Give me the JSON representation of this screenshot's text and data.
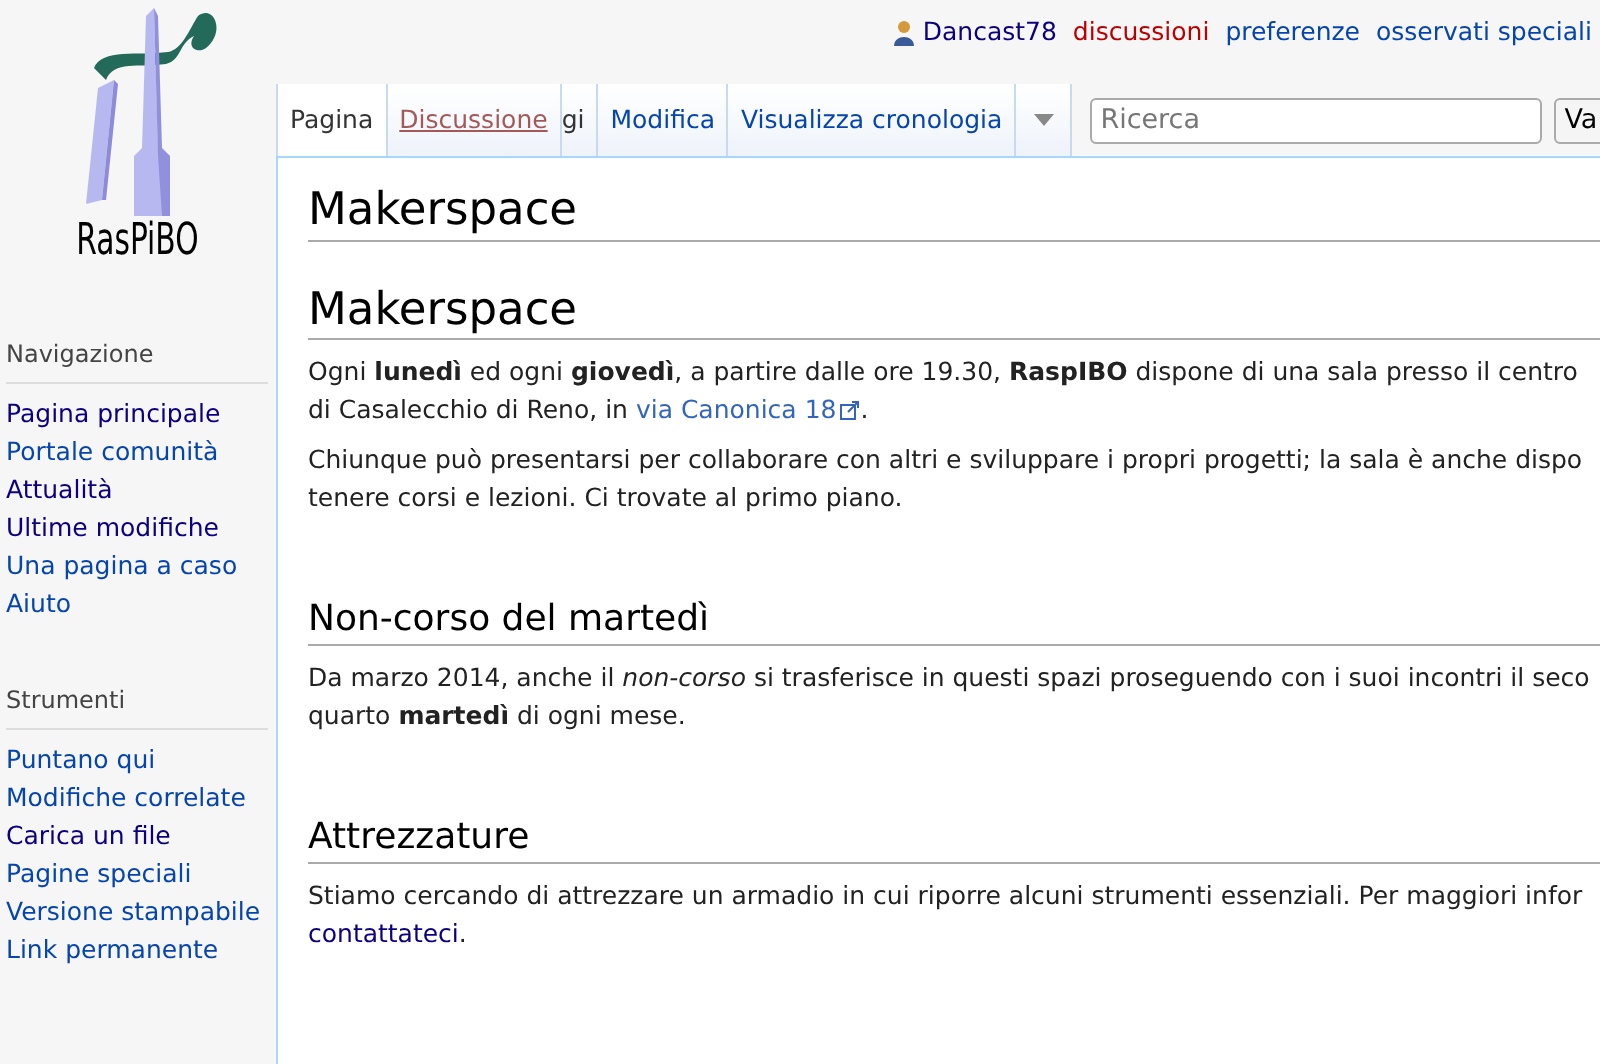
{
  "logo": {
    "text": "RasPiBO"
  },
  "personal_links": [
    {
      "label": "Dancast78",
      "kind": "user"
    },
    {
      "label": "discussioni",
      "kind": "new"
    },
    {
      "label": "preferenze",
      "kind": "link"
    },
    {
      "label": "osservati speciali",
      "kind": "link"
    }
  ],
  "tabs": [
    {
      "label": "Pagina",
      "selected": true,
      "kind": "tab"
    },
    {
      "label": "Discussione",
      "selected": false,
      "kind": "new"
    },
    {
      "label": "gi",
      "selected": false,
      "kind": "hidden"
    },
    {
      "label": "Modifica",
      "selected": false,
      "kind": "tab"
    },
    {
      "label": "Visualizza cronologia",
      "selected": false,
      "kind": "tab"
    }
  ],
  "search": {
    "placeholder": "Ricerca",
    "button": "Va"
  },
  "sidebar": [
    {
      "title": "Navigazione",
      "items": [
        {
          "label": "Pagina principale",
          "visited": true
        },
        {
          "label": "Portale comunità",
          "visited": false
        },
        {
          "label": "Attualità",
          "visited": true
        },
        {
          "label": "Ultime modifiche",
          "visited": true
        },
        {
          "label": "Una pagina a caso",
          "visited": false
        },
        {
          "label": "Aiuto",
          "visited": false
        }
      ]
    },
    {
      "title": "Strumenti",
      "items": [
        {
          "label": "Puntano qui",
          "visited": false
        },
        {
          "label": "Modifiche correlate",
          "visited": false
        },
        {
          "label": "Carica un file",
          "visited": true
        },
        {
          "label": "Pagine speciali",
          "visited": false
        },
        {
          "label": "Versione stampabile",
          "visited": false
        },
        {
          "label": "Link permanente",
          "visited": false
        }
      ]
    }
  ],
  "page_title": "Makerspace",
  "sections": [
    {
      "heading": "Makerspace",
      "kind": "title",
      "paragraphs": [
        [
          [
            {
              "kind": "text",
              "text": "Ogni **lunedì** ed ogni **giovedì**, a partire dalle ore 19.30, **RaspIBO** dispone di una sala presso il centro"
            }
          ],
          [
            {
              "kind": "text",
              "text": "di Casalecchio di Reno, in "
            },
            {
              "kind": "external",
              "text": "via Canonica 18"
            },
            {
              "kind": "text",
              "text": "."
            }
          ]
        ],
        [
          [
            {
              "kind": "text",
              "text": "Chiunque può presentarsi per collaborare con altri e sviluppare i propri progetti; la sala è anche dispo"
            }
          ],
          [
            {
              "kind": "text",
              "text": "tenere corsi e lezioni. Ci trovate al primo piano."
            }
          ]
        ]
      ]
    },
    {
      "heading": "Non-corso del martedì",
      "kind": "section",
      "paragraphs": [
        [
          [
            {
              "kind": "text",
              "text": "Da marzo 2014, anche il *non-corso* si trasferisce in questi spazi proseguendo con i suoi incontri il seco"
            }
          ],
          [
            {
              "kind": "text",
              "text": "quarto **martedì** di ogni mese."
            }
          ]
        ]
      ]
    },
    {
      "heading": "Attrezzature",
      "kind": "section",
      "paragraphs": [
        [
          [
            {
              "kind": "text",
              "text": "Stiamo cercando di attrezzare un armadio in cui riporre alcuni strumenti essenziali. Per maggiori infor"
            }
          ],
          [
            {
              "kind": "link",
              "text": "contattateci"
            },
            {
              "kind": "text",
              "text": "."
            }
          ]
        ]
      ]
    }
  ]
}
